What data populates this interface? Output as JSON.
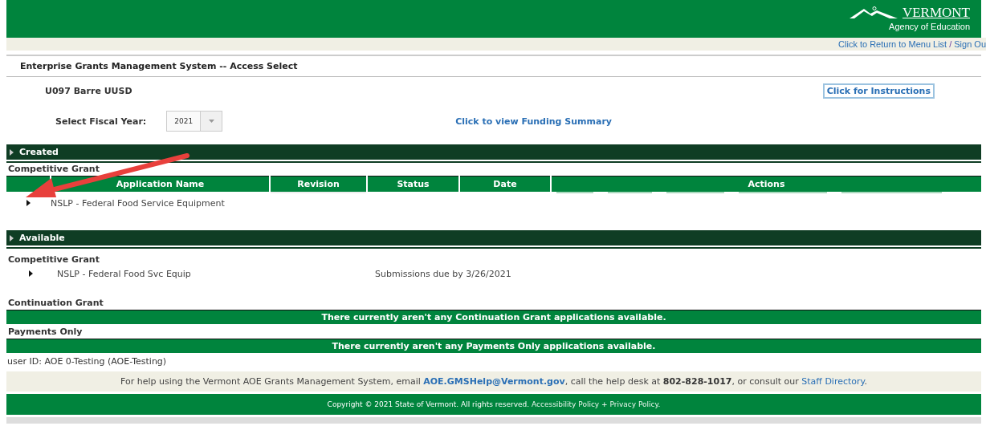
{
  "header": {
    "logo_name": "VERMONT",
    "logo_subtitle": "Agency of Education"
  },
  "nav_links": [
    "Click to Return to Menu List",
    "Sign Ou"
  ],
  "nav_separator": "/",
  "page_title": "Enterprise Grants Management System -- Access Select",
  "organization": "U097 Barre UUSD",
  "instructions_button": "Click for Instructions",
  "fiscal_year": {
    "label": "Select Fiscal Year:",
    "value": "2021"
  },
  "funding_summary_link": "Click to view Funding Summary",
  "created": {
    "title": "Created",
    "expanded": false,
    "group": "Competitive Grant",
    "columns": [
      "Application Name",
      "Revision",
      "Status",
      "Date",
      "Actions"
    ],
    "rows": [
      {
        "name": "NSLP - Federal Food Service Equipment",
        "expanded": false
      }
    ]
  },
  "available": {
    "title": "Available",
    "expanded": false,
    "groups": [
      {
        "kind": "list",
        "title": "Competitive Grant",
        "items": [
          {
            "name": "NSLP - Federal Food Svc Equip",
            "due": "Submissions due by 3/26/2021",
            "expanded": false
          }
        ]
      },
      {
        "kind": "notice",
        "title": "Continuation Grant",
        "notice": "There currently aren't any Continuation Grant applications available."
      },
      {
        "kind": "notice",
        "title": "Payments Only",
        "notice": "There currently aren't any Payments Only applications available."
      }
    ]
  },
  "user_id": "user ID: AOE 0-Testing (AOE-Testing)",
  "help": [
    {
      "kind": "text",
      "text": "For help using the Vermont AOE Grants Management System, email "
    },
    {
      "kind": "link",
      "text": "AOE.GMSHelp@Vermont.gov"
    },
    {
      "kind": "text",
      "text": ", call the help desk at "
    },
    {
      "kind": "bold",
      "text": "802-828-1017"
    },
    {
      "kind": "text",
      "text": ", or consult our "
    },
    {
      "kind": "link",
      "text": "Staff Directory"
    },
    {
      "kind": "text",
      "text": "."
    }
  ],
  "footer": [
    {
      "kind": "text",
      "text": "Copyright © 2021 State of Vermont. All rights reserved. "
    },
    {
      "kind": "link",
      "text": "Accessibility Policy"
    },
    {
      "kind": "text",
      "text": " + "
    },
    {
      "kind": "link",
      "text": "Privacy Policy"
    },
    {
      "kind": "text",
      "text": "."
    }
  ]
}
